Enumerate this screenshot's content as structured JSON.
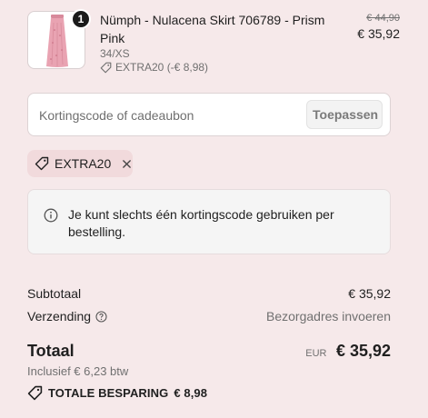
{
  "product": {
    "quantity": "1",
    "name": "Nümph - Nulacena Skirt 706789 - Prism Pink",
    "variant": "34/XS",
    "discount": "EXTRA20 (-€ 8,98)",
    "old_price": "€ 44,90",
    "new_price": "€ 35,92",
    "image_icon": "pink-skirt-thumbnail"
  },
  "code_field": {
    "placeholder": "Kortingscode of cadeaubon",
    "value": "",
    "apply_label": "Toepassen"
  },
  "applied_code": {
    "label": "EXTRA20",
    "icon": "tag-icon",
    "remove_icon": "close-icon"
  },
  "notice": {
    "icon": "info-icon",
    "text": "Je kunt slechts één kortingscode gebruiken per bestelling."
  },
  "summary": {
    "subtotal_label": "Subtotaal",
    "subtotal_value": "€ 35,92",
    "shipping_label": "Verzending",
    "shipping_help_icon": "help-icon",
    "shipping_value": "Bezorgadres invoeren",
    "total_label": "Totaal",
    "currency": "EUR",
    "total_value": "€ 35,92",
    "vat": "Inclusief € 6,23 btw",
    "savings_label": "TOTALE BESPARING",
    "savings_value": "€ 8,98"
  },
  "colors": {
    "background": "#f6e9ea",
    "chip_bg": "#f1dadc",
    "text": "#1f1f1f",
    "muted": "#707070"
  }
}
